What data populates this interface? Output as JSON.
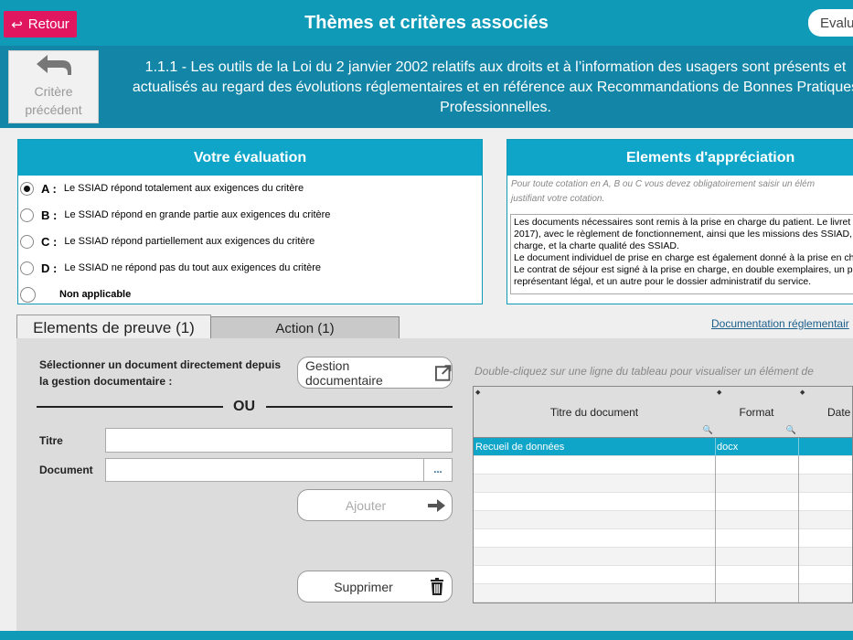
{
  "header": {
    "back_label": "Retour",
    "title": "Thèmes et critères associés",
    "right_pill": "Evalua"
  },
  "criterion": {
    "prev_label_1": "Critère",
    "prev_label_2": "précédent",
    "text": "1.1.1 - Les outils de la Loi du 2 janvier 2002 relatifs aux droits et à l’information des usagers sont présents et actualisés au regard des évolutions réglementaires et en référence aux Recommandations de Bonnes Pratiques Professionnelles."
  },
  "evaluation": {
    "title": "Votre évaluation",
    "options": [
      {
        "letter": "A :",
        "text": "Le SSIAD répond totalement aux exigences du critère",
        "selected": true
      },
      {
        "letter": "B :",
        "text": "Le SSIAD répond en grande partie aux exigences du critère",
        "selected": false
      },
      {
        "letter": "C :",
        "text": "Le SSIAD répond partiellement aux exigences du critère",
        "selected": false
      },
      {
        "letter": "D :",
        "text": "Le SSIAD ne répond pas du tout aux exigences du critère",
        "selected": false
      },
      {
        "letter": "",
        "text": "Non applicable",
        "selected": false
      }
    ]
  },
  "appreciation": {
    "title": "Elements d'appréciation",
    "hint_1": "Pour toute cotation en A, B ou C vous devez obligatoirement saisir un élém",
    "hint_2": "justifiant votre cotation.",
    "lines": [
      "Les documents nécessaires sont remis à la prise en charge du patient. Le livret",
      "2017), avec le règlement de fonctionnement, ainsi que les missions des SSIAD,",
      "charge, et la charte qualité des SSIAD.",
      "Le document individuel de prise en charge est également donné à la prise en ch",
      "Le contrat de séjour est signé à la prise en charge, en double exemplaires, un p",
      "représentant légal, et un autre pour le dossier administratif du service."
    ]
  },
  "tabs": {
    "evidence": "Elements de preuve (1)",
    "action": "Action (1)",
    "doc_link": "Documentation réglementair"
  },
  "evidence": {
    "select_text_1": "Sélectionner un document directement depuis",
    "select_text_2": "la gestion documentaire :",
    "gestion_btn": "Gestion documentaire",
    "ou": "OU",
    "titre_label": "Titre",
    "document_label": "Document",
    "titre_value": "",
    "document_value": "",
    "browse_btn": "...",
    "add_btn": "Ajouter",
    "delete_btn": "Supprimer",
    "table_hint": "Double-cliquez sur une ligne du tableau pour visualiser un élément de"
  },
  "table": {
    "columns": [
      "Titre du document",
      "Format",
      "Date"
    ],
    "rows": [
      {
        "title": "Recueil de données",
        "format": "docx",
        "date": ""
      }
    ]
  },
  "colors": {
    "accent": "#0f9ab8",
    "back_button": "#e0165f",
    "selected_row": "#0ea5c9"
  }
}
